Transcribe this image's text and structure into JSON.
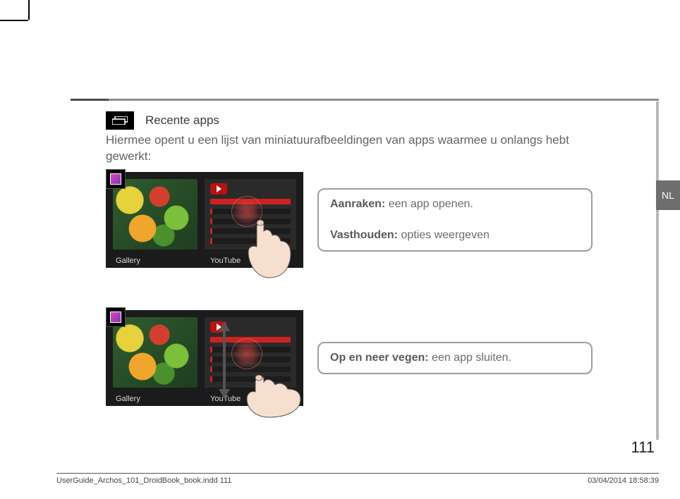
{
  "language_tab": "NL",
  "heading": "Recente apps",
  "intro": "Hiermee opent u een lijst van miniatuurafbeeldingen van apps waarmee u onlangs hebt gewerkt:",
  "thumbnail_labels": {
    "gallery": "Gallery",
    "youtube": "YouTube"
  },
  "callout1": {
    "touch_label": "Aanraken:",
    "touch_text": " een app openen.",
    "hold_label": "Vasthouden:",
    "hold_text": " opties weergeven"
  },
  "callout2": {
    "swipe_label": "Op en neer vegen:",
    "swipe_text": " een app sluiten."
  },
  "page_number": "111",
  "footer": {
    "left": "UserGuide_Archos_101_DroidBook_book.indd   111",
    "right": "03/04/2014   18:58:39"
  }
}
